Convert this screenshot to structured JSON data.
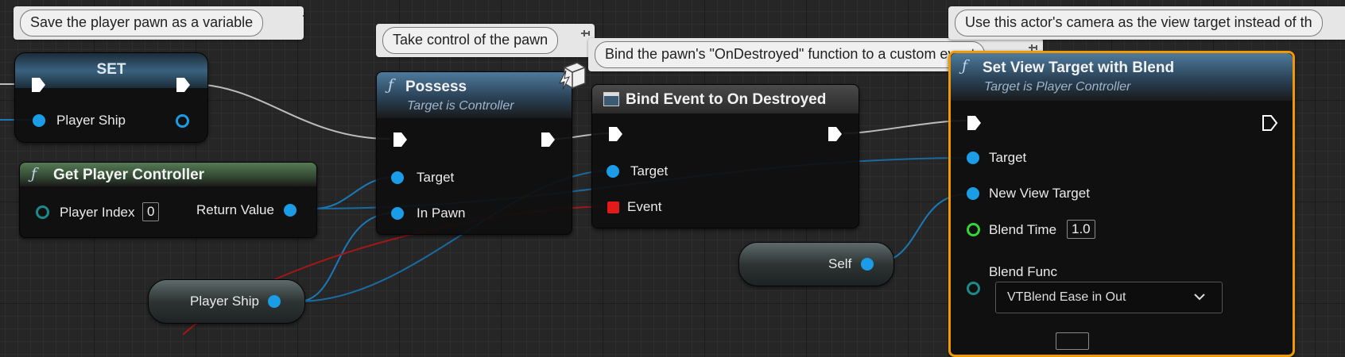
{
  "comments": {
    "save_pawn": "Save the player pawn as a variable",
    "take_control": "Take control of the pawn",
    "bind_destroyed": "Bind the pawn's \"OnDestroyed\" function to a custom event",
    "use_camera": "Use this actor's camera as the view target instead of th"
  },
  "set_node": {
    "title": "SET",
    "pin_player_ship": "Player Ship"
  },
  "get_player_controller": {
    "icon": "function-icon",
    "title": "Get Player Controller",
    "pin_player_index": "Player Index",
    "player_index_value": "0",
    "pin_return_value": "Return Value"
  },
  "player_ship_var": {
    "label": "Player Ship"
  },
  "possess": {
    "icon": "function-icon",
    "title": "Possess",
    "subtitle": "Target is Controller",
    "pin_target": "Target",
    "pin_in_pawn": "In Pawn"
  },
  "bind_event": {
    "icon": "event-dispatcher-icon",
    "title": "Bind Event to On Destroyed",
    "pin_target": "Target",
    "pin_event": "Event"
  },
  "self_node": {
    "label": "Self"
  },
  "set_view_target": {
    "icon": "function-icon",
    "title": "Set View Target with Blend",
    "subtitle": "Target is Player Controller",
    "pin_target": "Target",
    "pin_new_view_target": "New View Target",
    "pin_blend_time": "Blend Time",
    "blend_time_value": "1.0",
    "pin_blend_func": "Blend Func",
    "blend_func_value": "VTBlend Ease in Out"
  },
  "colors": {
    "object_pin": "#1a9ce6",
    "exec_pin": "#ffffff",
    "delegate_pin": "#e21a1a",
    "float_pin": "#33d633",
    "selection": "#f19a00",
    "function_header": "#2a4257",
    "pure_header": "#324832"
  }
}
